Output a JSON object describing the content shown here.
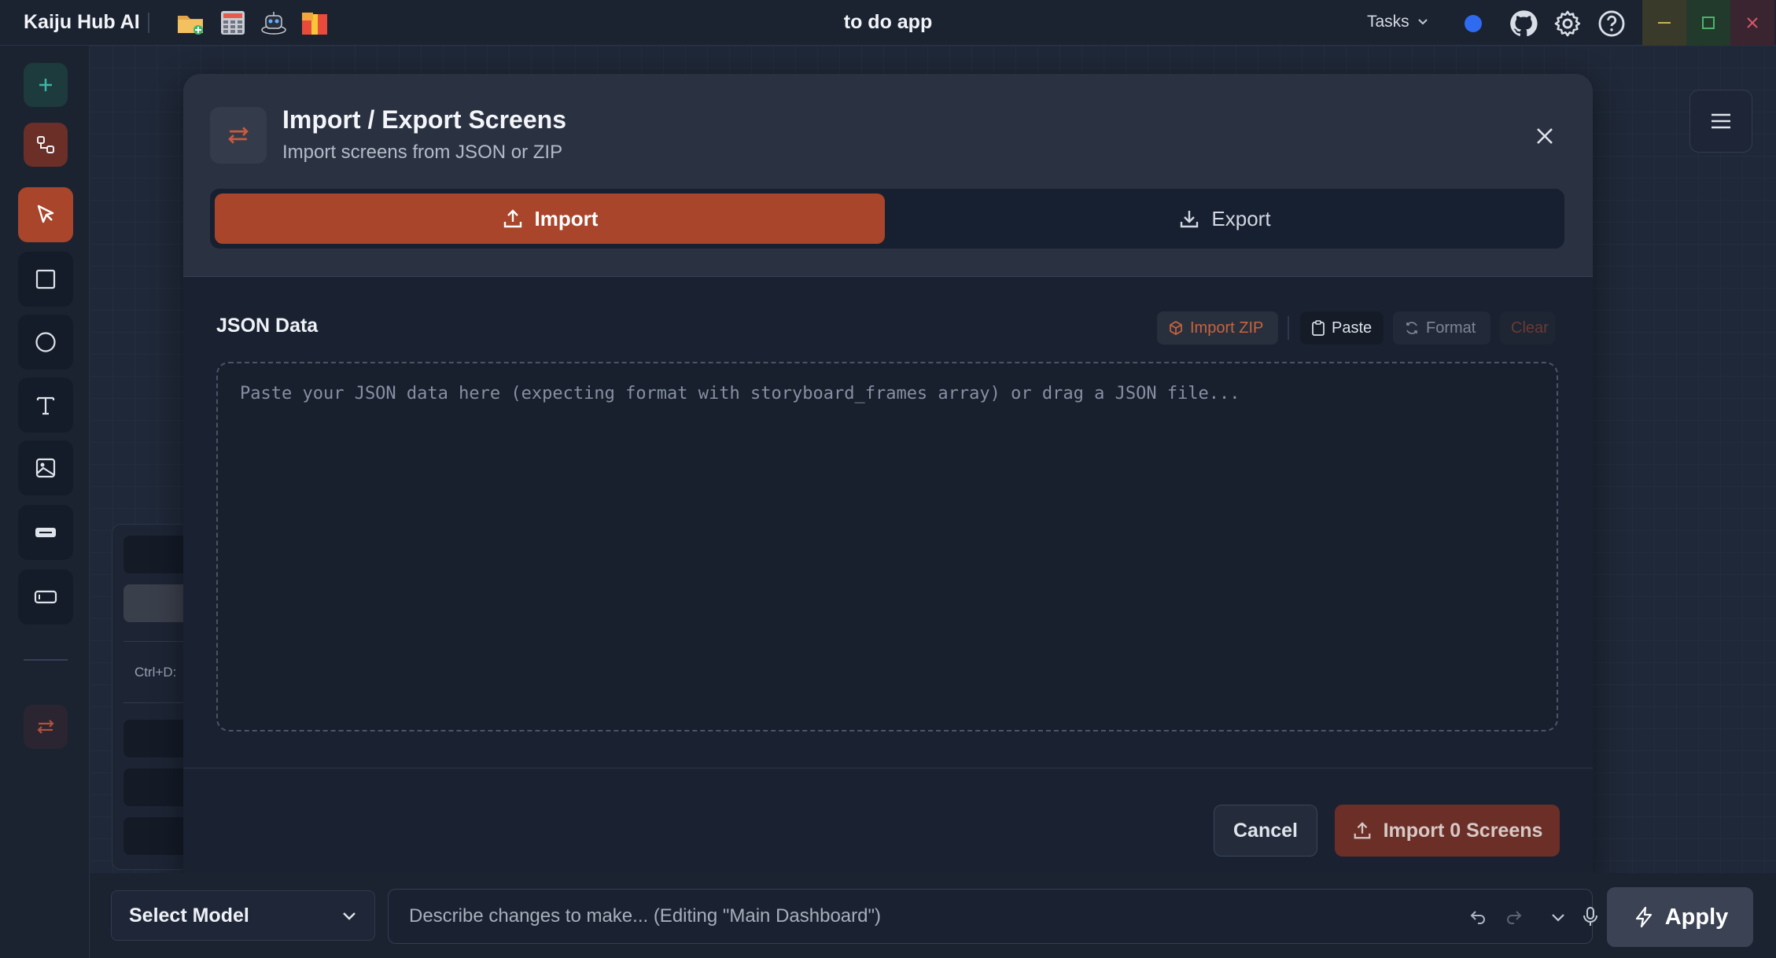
{
  "titlebar": {
    "app_name": "Kaiju Hub AI",
    "window_title": "to do app",
    "tasks_label": "Tasks",
    "quick_icons": [
      "folder-icon",
      "calculator-icon",
      "robot-icon",
      "gift-box-icon"
    ],
    "status_dot_color": "#2f6bf0",
    "window_controls": [
      "minimize",
      "maximize",
      "close"
    ]
  },
  "rail": {
    "tools": [
      "add",
      "flow-connector",
      "select-pointer",
      "rectangle",
      "ellipse",
      "text",
      "image",
      "button-component",
      "input-component",
      "import-export"
    ],
    "accent_color": "#a8452a"
  },
  "left_panel": {
    "shortcut_hint": "Ctrl+D:"
  },
  "modal": {
    "title": "Import / Export Screens",
    "subtitle": "Import screens from JSON or ZIP",
    "tabs": [
      {
        "label": "Import",
        "active": true
      },
      {
        "label": "Export",
        "active": false
      }
    ],
    "json_section": {
      "label": "JSON Data",
      "import_zip_label": "Import ZIP",
      "paste_label": "Paste",
      "format_label": "Format",
      "clear_label": "Clear",
      "placeholder": "Paste your JSON data here (expecting format with storyboard_frames array) or drag a JSON file..."
    },
    "footer": {
      "cancel_label": "Cancel",
      "import_label": "Import 0 Screens"
    }
  },
  "bottom_bar": {
    "model_select_label": "Select Model",
    "prompt_placeholder": "Describe changes to make... (Editing \"Main Dashboard\")",
    "apply_label": "Apply"
  }
}
